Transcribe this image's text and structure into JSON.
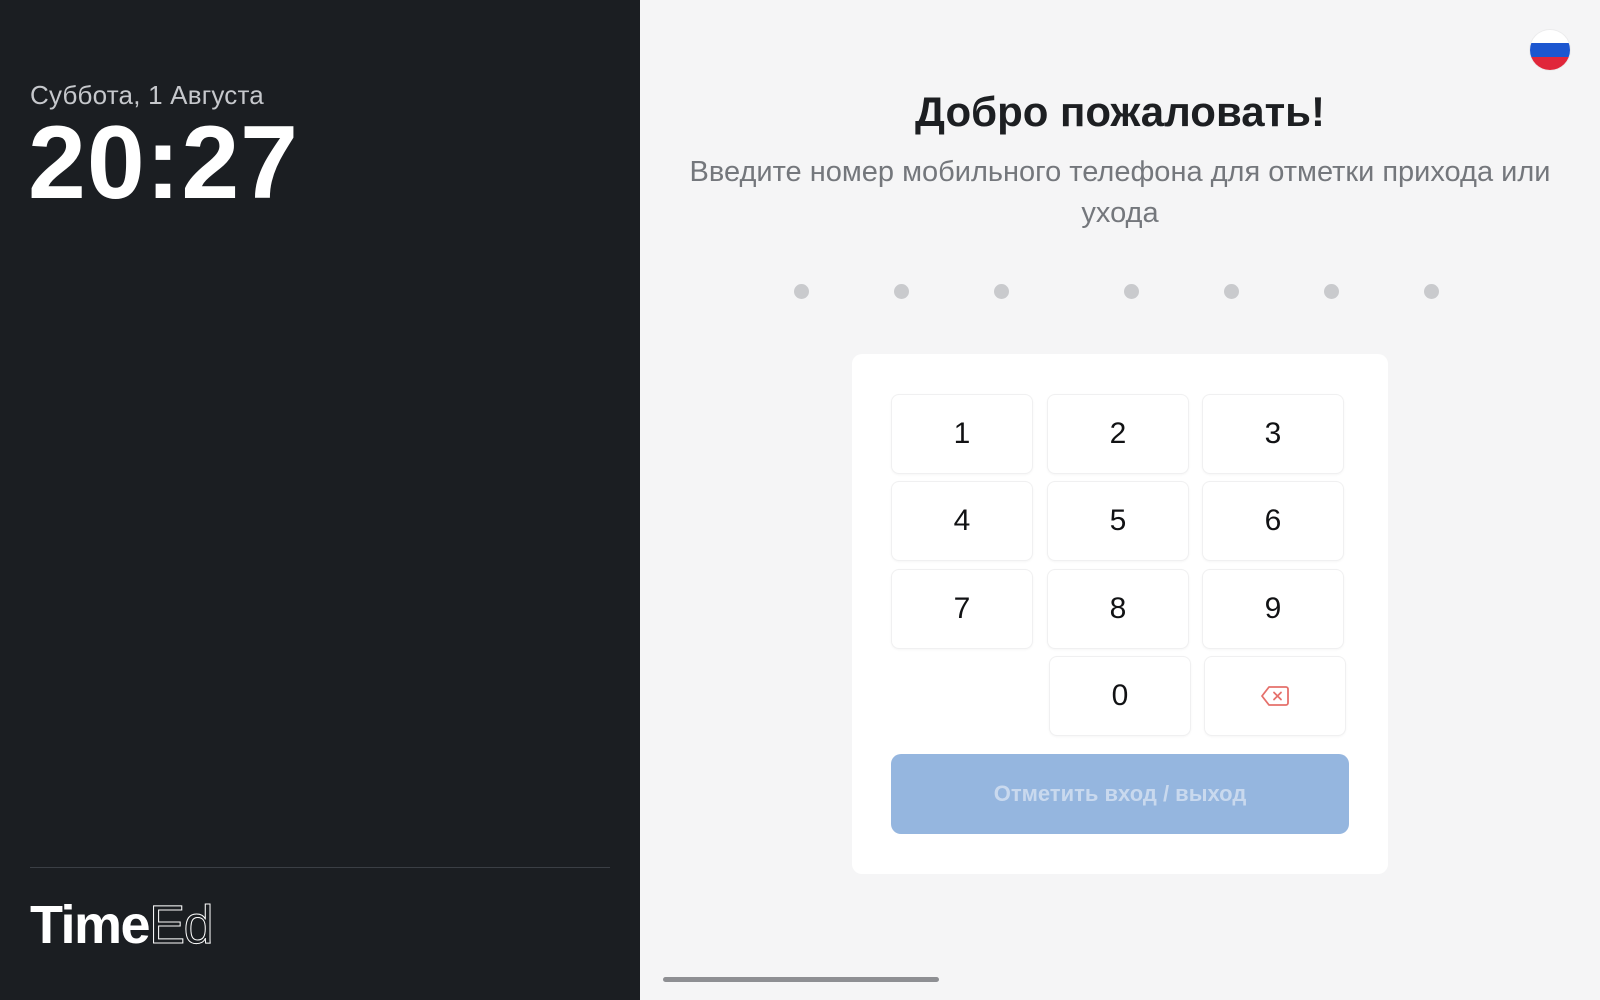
{
  "sidebar": {
    "date": "Суббота, 1 Августа",
    "time": "20:27",
    "brand_bold": "Time",
    "brand_thin": "Ed"
  },
  "header": {
    "language_flag": "russia-flag-icon",
    "title": "Добро пожаловать!",
    "subtitle": "Введите номер мобильного телефона для отметки прихода или ухода"
  },
  "phone_input": {
    "digits_entered": 0,
    "digit_slots": 7
  },
  "keypad": {
    "keys": [
      "1",
      "2",
      "3",
      "4",
      "5",
      "6",
      "7",
      "8",
      "9",
      "0"
    ],
    "backspace_icon": "backspace-icon",
    "submit_label": "Отметить вход / выход"
  },
  "colors": {
    "left_panel_bg": "#1b1e22",
    "right_panel_bg": "#f5f5f6",
    "submit_disabled_bg": "#95b6df",
    "backspace_accent": "#e5706b",
    "flag_white": "#ffffff",
    "flag_blue": "#1c57d0",
    "flag_red": "#e0263a"
  }
}
